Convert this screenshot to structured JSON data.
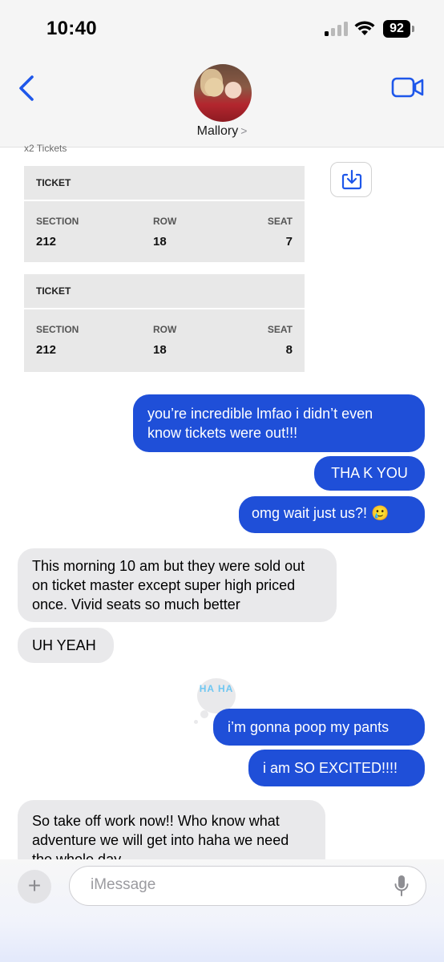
{
  "status": {
    "time": "10:40",
    "battery": "92"
  },
  "header": {
    "contact_name": "Mallory",
    "chevron": ">"
  },
  "tickets": {
    "caption": "x2 Tickets",
    "section_label": "SECTION",
    "row_label": "ROW",
    "seat_label": "SEAT",
    "items": [
      {
        "title": "TICKET",
        "section": "212",
        "row": "18",
        "seat": "7"
      },
      {
        "title": "TICKET",
        "section": "212",
        "row": "18",
        "seat": "8"
      }
    ]
  },
  "messages": [
    {
      "from": "me",
      "text": "you’re incredible lmfao i didn’t even know tickets were out!!!"
    },
    {
      "from": "me",
      "text": "THA K YOU"
    },
    {
      "from": "me",
      "text": "omg wait just us?! 🥲"
    },
    {
      "from": "them",
      "text": "This morning 10 am but they were sold out on ticket master except super high priced once. Vivid seats so much better"
    },
    {
      "from": "them",
      "text": "UH YEAH"
    },
    {
      "from": "me",
      "text": "i’m gonna poop my pants",
      "tapback": "HA HA"
    },
    {
      "from": "me",
      "text": "i am SO EXCITED!!!!"
    },
    {
      "from": "them",
      "text": "So take off work now!! Who know what adventure we will get into haha we need the whole day"
    }
  ],
  "compose": {
    "plus": "+",
    "placeholder": "iMessage"
  },
  "colors": {
    "sent_bubble": "#1f4fd8",
    "received_bubble": "#e9e9eb",
    "accent": "#1e57ea"
  },
  "icons": [
    "back-chevron-icon",
    "video-camera-icon",
    "save-download-icon",
    "microphone-icon",
    "plus-icon"
  ]
}
